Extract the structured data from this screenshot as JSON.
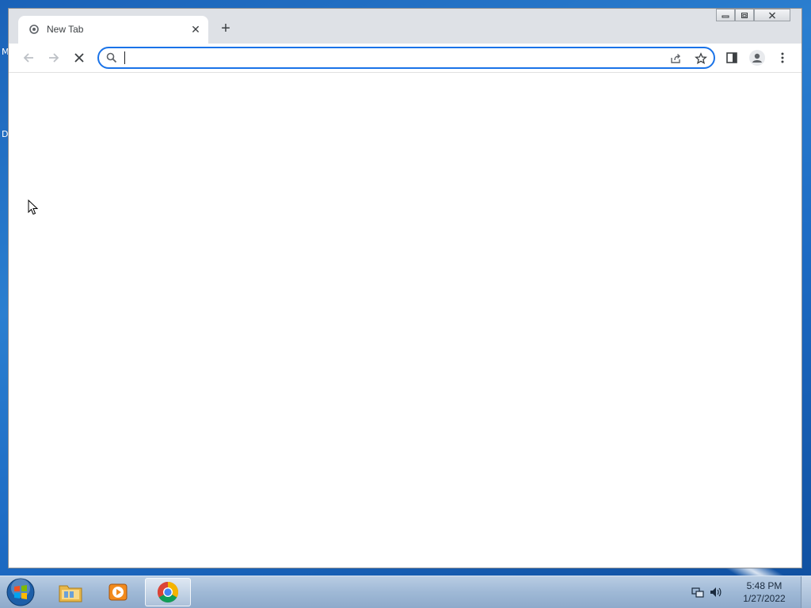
{
  "desktop": {
    "edge_letters": [
      "M",
      "D"
    ]
  },
  "browser": {
    "tab": {
      "title": "New Tab",
      "close_symbol": "✕",
      "favicon": "chrome-newtab-icon"
    },
    "new_tab_symbol": "+",
    "window_controls": [
      "minimize-icon",
      "restore-icon",
      "close-icon"
    ],
    "toolbar": {
      "back_icon": "arrow-left-icon",
      "forward_icon": "arrow-right-icon",
      "stop_icon": "stop-x-icon",
      "share_icon": "share-icon",
      "bookmark_icon": "star-icon",
      "side_panel_icon": "side-panel-icon",
      "profile_icon": "profile-icon",
      "menu_icon": "kebab-menu-icon"
    },
    "omnibox": {
      "value": "",
      "placeholder": "",
      "search_icon": "search-icon"
    }
  },
  "taskbar": {
    "start_icon": "windows-orb-icon",
    "pinned": [
      {
        "name": "explorer",
        "icon": "folder-icon"
      },
      {
        "name": "media-player",
        "icon": "media-player-icon"
      },
      {
        "name": "chrome",
        "icon": "chrome-icon",
        "active": true
      }
    ],
    "tray": {
      "network_icon": "network-icon",
      "volume_icon": "volume-icon"
    },
    "clock": {
      "time": "5:48 PM",
      "date": "1/27/2022"
    }
  },
  "colors": {
    "accent": "#1a73e8",
    "tabstrip": "#dee1e6",
    "desktop": "#1d6bc4"
  }
}
